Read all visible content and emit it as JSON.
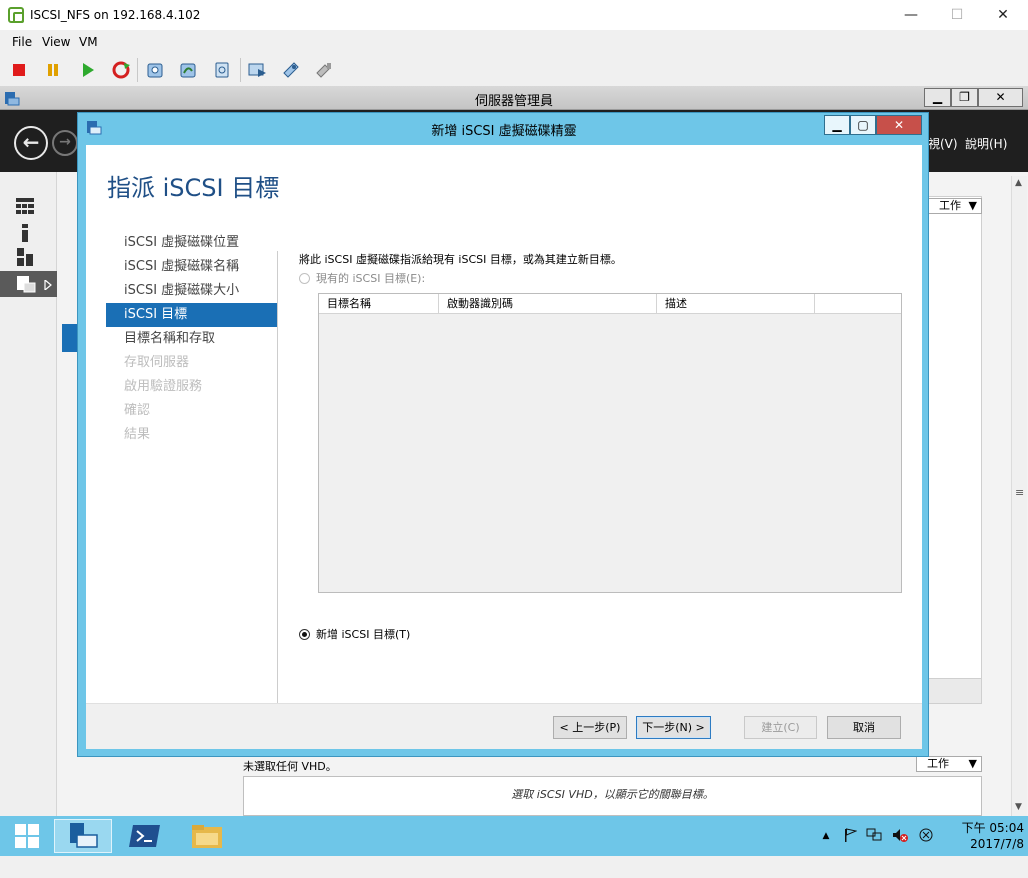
{
  "vm_window": {
    "title": "ISCSI_NFS on 192.168.4.102",
    "controls": {
      "minimize": "—",
      "maximize": "☐",
      "close": "✕"
    },
    "menu": [
      "File",
      "View",
      "VM"
    ]
  },
  "toolbar_icons": [
    "stop-icon",
    "pause-icon",
    "play-icon",
    "reset-icon",
    "snapshot-icon",
    "revert-snapshot-icon",
    "snapshot-manager-icon",
    "console-icon",
    "settings-icon",
    "connect-device-icon"
  ],
  "server_manager": {
    "title": "伺服器管理員",
    "controls": {
      "minimize": "▁",
      "restore": "❐",
      "close": "✕"
    },
    "menu": [
      "視(V)",
      "說明(H)"
    ],
    "nav_back": "←",
    "nav_forward": "→",
    "task_label": "工作",
    "task_label_2": "工作",
    "vhd_note": "未選取任何 VHD。",
    "vhd_placeholder": "選取 iSCSI VHD，以顯示它的關聯目標。"
  },
  "wizard": {
    "title": "新增 iSCSI 虛擬磁碟精靈",
    "controls": {
      "minimize": "▁",
      "maximize": "▢",
      "close": "✕"
    },
    "heading": "指派 iSCSI 目標",
    "steps": [
      {
        "label": "iSCSI 虛擬磁碟位置",
        "state": "normal"
      },
      {
        "label": "iSCSI 虛擬磁碟名稱",
        "state": "normal"
      },
      {
        "label": "iSCSI 虛擬磁碟大小",
        "state": "normal"
      },
      {
        "label": "iSCSI 目標",
        "state": "active"
      },
      {
        "label": "目標名稱和存取",
        "state": "normal"
      },
      {
        "label": "存取伺服器",
        "state": "disabled"
      },
      {
        "label": "啟用驗證服務",
        "state": "disabled"
      },
      {
        "label": "確認",
        "state": "disabled"
      },
      {
        "label": "結果",
        "state": "disabled"
      }
    ],
    "description": "將此 iSCSI 虛擬磁碟指派給現有 iSCSI 目標，或為其建立新目標。",
    "option_existing": "現有的 iSCSI 目標(E):",
    "option_new": "新增 iSCSI 目標(T)",
    "selected_option": "new",
    "table_columns": [
      "目標名稱",
      "啟動器識別碼",
      "描述",
      ""
    ],
    "buttons": {
      "back": "< 上一步(P)",
      "next": "下一步(N) >",
      "create": "建立(C)",
      "cancel": "取消"
    }
  },
  "taskbar": {
    "time": "下午 05:04",
    "date": "2017/7/8",
    "tray_expand": "▲"
  }
}
